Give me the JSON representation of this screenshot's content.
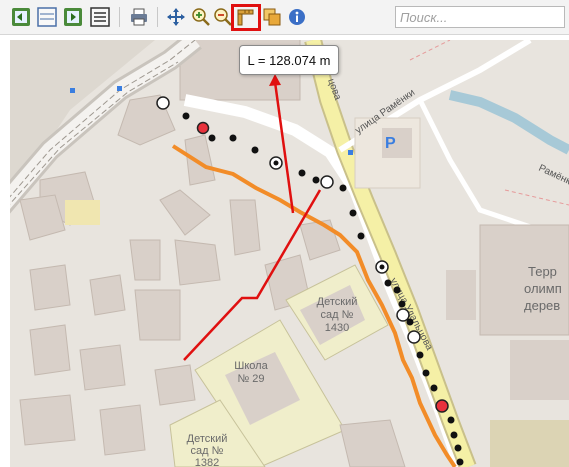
{
  "toolbar": {
    "search_placeholder": "Поиск...",
    "buttons": [
      "zoom-extent-icon",
      "map-layers-icon",
      "next-extent-icon",
      "list-view-icon",
      "print-icon",
      "pan-icon",
      "zoom-in-icon",
      "zoom-out-icon",
      "measure-distance-icon",
      "measure-area-icon",
      "info-icon"
    ],
    "active_tool": "measure-distance"
  },
  "measurement": {
    "label": "L = 128.074 m"
  },
  "map": {
    "street_1": "улица Рамёнки",
    "street_2": "улица Удальцова",
    "street_3": "Рамёнки",
    "street_4_fragment": "цова",
    "parking": "P",
    "kindergarten_1_line1": "Детский",
    "kindergarten_1_line2": "сад №",
    "kindergarten_1_line3": "1430",
    "school_line1": "Школа",
    "school_line2": "№ 29",
    "kindergarten_2_line1": "Детский",
    "kindergarten_2_line2": "сад №",
    "kindergarten_2_line3": "1382",
    "territory_line1": "Терр",
    "territory_line2": "олимп",
    "territory_line3": "дерев"
  },
  "colors": {
    "route": "#f28c28",
    "annotation": "#e01010",
    "building": "#d9d0c9",
    "landuse_school": "#f0eecb",
    "major_road": "#f5f0a6"
  }
}
